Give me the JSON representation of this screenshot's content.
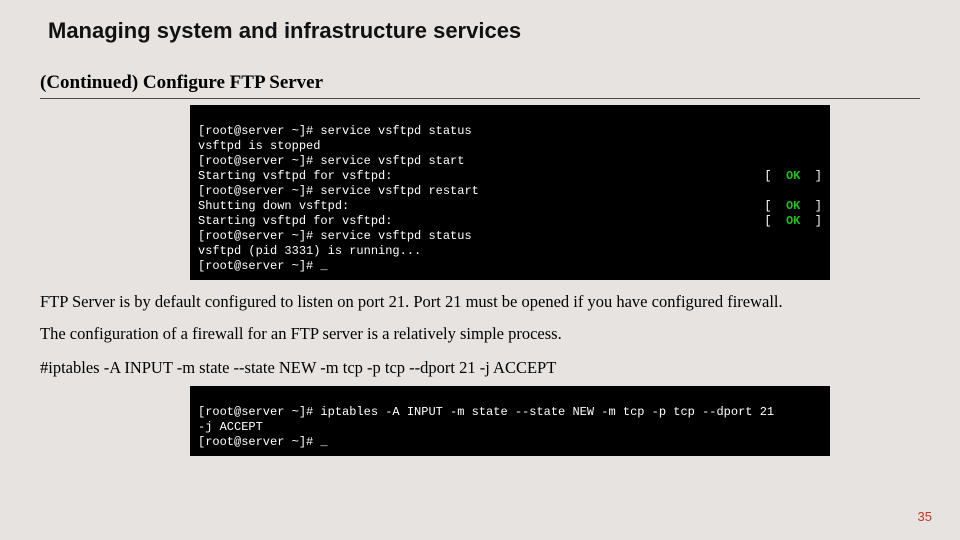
{
  "title": "Managing system and infrastructure services",
  "subtitle": "(Continued) Configure FTP Server",
  "terminal1": {
    "l1": "[root@server ~]# service vsftpd status",
    "l2": "vsftpd is stopped",
    "l3": "[root@server ~]# service vsftpd start",
    "l4_left": "Starting vsftpd for vsftpd:",
    "l4_right_open": "[  ",
    "l4_ok": "OK",
    "l4_right_close": "  ]",
    "l5": "[root@server ~]# service vsftpd restart",
    "l6_left": "Shutting down vsftpd:",
    "l6_right_open": "[  ",
    "l6_ok": "OK",
    "l6_right_close": "  ]",
    "l7_left": "Starting vsftpd for vsftpd:",
    "l7_right_open": "[  ",
    "l7_ok": "OK",
    "l7_right_close": "  ]",
    "l8": "[root@server ~]# service vsftpd status",
    "l9": "vsftpd (pid 3331) is running...",
    "l10": "[root@server ~]# _"
  },
  "body_p1": "FTP Server is by default configured to listen on port 21. Port 21 must be opened if you have configured firewall.",
  "body_p2": "The configuration of a firewall for an FTP server is a relatively simple process.",
  "cmdline": "#iptables -A INPUT -m state --state NEW -m tcp -p tcp --dport 21 -j ACCEPT",
  "terminal2": {
    "l1": "[root@server ~]# iptables -A INPUT -m state --state NEW -m tcp -p tcp --dport 21",
    "l2": "-j ACCEPT",
    "l3": "[root@server ~]# _"
  },
  "page_number": "35"
}
